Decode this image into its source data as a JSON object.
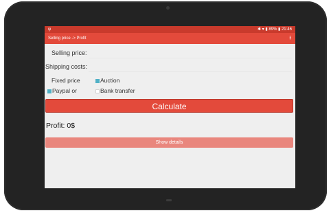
{
  "status_bar": {
    "left_icon": "notification-icon",
    "right_text": "✱ ▾ ▮ 89% ▮ 21:46"
  },
  "app_bar": {
    "title": "Selling price -> Profit",
    "overflow": "⋮"
  },
  "form": {
    "selling_price_label": "Selling price:",
    "selling_price_value": "",
    "shipping_costs_label": "Shipping costs:",
    "shipping_costs_value": ""
  },
  "options": {
    "fixed_price_label": "Fixed price",
    "auction_label": "Auction",
    "paypal_label": "Paypal or",
    "bank_transfer_label": "Bank transfer"
  },
  "calculate_label": "Calculate",
  "profit_text": "Profit: 0$",
  "show_details_label": "Show details",
  "colors": {
    "accent": "#e34a3b",
    "accent_dark": "#c93a2c",
    "details_button": "#e9867d",
    "checkbox": "#4fb0c6"
  }
}
